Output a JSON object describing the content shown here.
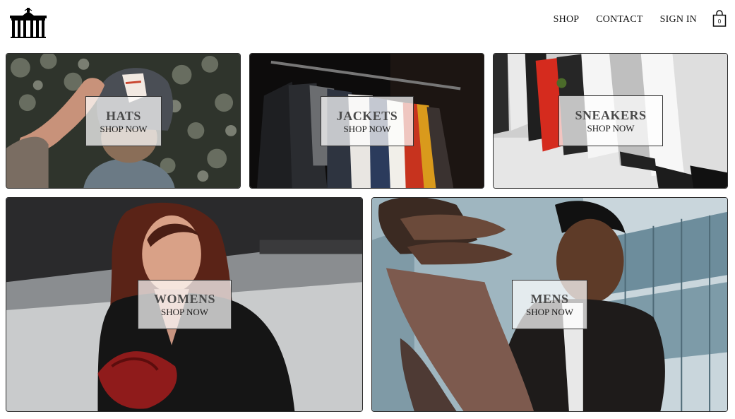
{
  "header": {
    "nav": [
      {
        "label": "SHOP"
      },
      {
        "label": "CONTACT"
      },
      {
        "label": "SIGN IN"
      }
    ],
    "cart_count": "0",
    "logo_icon": "brandenburg-gate-icon",
    "cart_icon": "shopping-bag-icon"
  },
  "categories": [
    {
      "title": "HATS",
      "cta": "SHOP NOW"
    },
    {
      "title": "JACKETS",
      "cta": "SHOP NOW"
    },
    {
      "title": "SNEAKERS",
      "cta": "SHOP NOW"
    },
    {
      "title": "WOMENS",
      "cta": "SHOP NOW"
    },
    {
      "title": "MENS",
      "cta": "SHOP NOW"
    }
  ]
}
